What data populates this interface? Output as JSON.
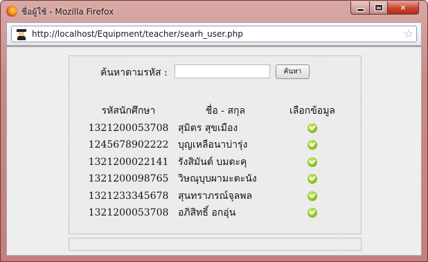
{
  "window": {
    "title": "ชื่อผู้ใช้ - Mozilla Firefox"
  },
  "address_bar": {
    "url": "http://localhost/Equipment/teacher/searh_user.php"
  },
  "search": {
    "label": "ค้นหาตามรหัส :",
    "value": "",
    "button_label": "ค้นหา"
  },
  "table": {
    "headers": {
      "id": "รหัสนักศึกษา",
      "name": "ชื่อ - สกุล",
      "pick": "เลือกข้อมูล"
    },
    "rows": [
      {
        "id": "1321200053708",
        "name": "สุมิตร สุขเมือง",
        "pick_icon": "check-icon"
      },
      {
        "id": "1245678902222",
        "name": "บุญเหลือนาบ่ารุ่ง",
        "pick_icon": "check-icon"
      },
      {
        "id": "1321200022141",
        "name": "รังสิมันต์ บมตะคุ",
        "pick_icon": "check-icon"
      },
      {
        "id": "1321200098765",
        "name": "วิษณุบุบผามะตะนัง",
        "pick_icon": "check-icon"
      },
      {
        "id": "1321233345678",
        "name": "สุนทราภรณ์จุลพล",
        "pick_icon": "check-icon"
      },
      {
        "id": "1321200053708",
        "name": "อภิสิทธิ์ อกอุ่น",
        "pick_icon": "check-icon"
      }
    ]
  },
  "colors": {
    "check": "#8ec21e",
    "titlebar": "#c98a86"
  }
}
